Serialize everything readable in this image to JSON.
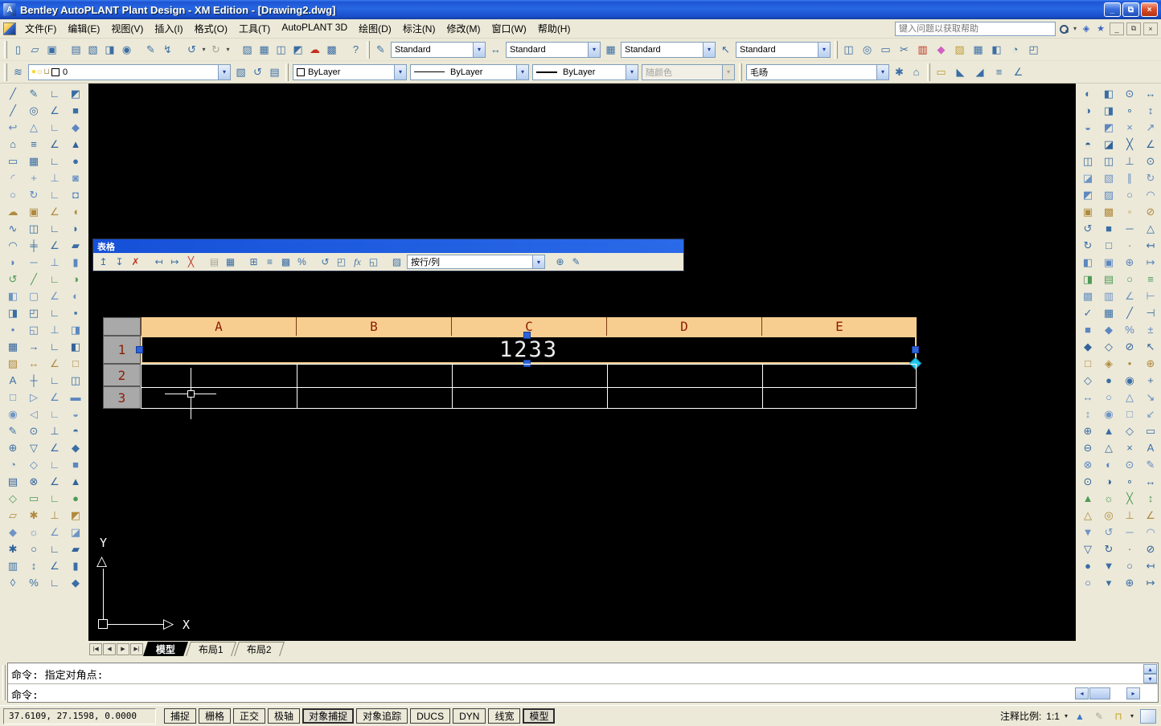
{
  "window": {
    "title": "Bentley AutoPLANT Plant Design - XM Edition - [Drawing2.dwg]",
    "app_initial": "A",
    "minimize": "_",
    "restore": "⧉",
    "close": "×"
  },
  "menubar": {
    "items": [
      "文件(F)",
      "编辑(E)",
      "视图(V)",
      "插入(I)",
      "格式(O)",
      "工具(T)",
      "AutoPLANT 3D",
      "绘图(D)",
      "标注(N)",
      "修改(M)",
      "窗口(W)",
      "帮助(H)"
    ],
    "search_placeholder": "键入问题以获取帮助",
    "comm_icon": "◈",
    "star_icon": "★",
    "doc_minimize": "_",
    "doc_restore": "⧉",
    "doc_close": "×"
  },
  "icons": {
    "combo_arrow": "▾",
    "up": "▴",
    "down": "▾",
    "left": "◂",
    "right": "▸"
  },
  "toolbar1": {
    "left_icons": [
      {
        "name": "new-icon",
        "g": "▯"
      },
      {
        "name": "open-icon",
        "g": "▱"
      },
      {
        "name": "save-icon",
        "g": "▣"
      },
      {
        "name": "plot-icon",
        "g": "▤",
        "class": "sep"
      },
      {
        "name": "plot-preview-icon",
        "g": "▧"
      },
      {
        "name": "publish-icon",
        "g": "◨"
      },
      {
        "name": "dwf-icon",
        "g": "◉"
      },
      {
        "name": "paint-icon",
        "g": "✎",
        "class": "sep"
      },
      {
        "name": "match-properties-icon",
        "g": "↯"
      },
      {
        "name": "undo-icon",
        "g": "↺",
        "class": "sep"
      },
      {
        "name": "undo-arrow-icon",
        "g": "▾",
        "class": "dd"
      },
      {
        "name": "redo-icon",
        "g": "↻",
        "class": "dim"
      },
      {
        "name": "redo-arrow-icon",
        "g": "▾",
        "class": "dd"
      },
      {
        "name": "sheet-set-icon",
        "g": "▨",
        "class": "sep"
      },
      {
        "name": "quickcalc-icon",
        "g": "▦"
      },
      {
        "name": "block-editor-icon",
        "g": "◫"
      },
      {
        "name": "markup-icon",
        "g": "◩"
      },
      {
        "name": "revision-icon",
        "g": "☁",
        "class": "red"
      },
      {
        "name": "calculator-icon",
        "g": "▩"
      },
      {
        "name": "help-icon",
        "g": "?",
        "class": "sep"
      }
    ],
    "styles": [
      {
        "name": "text-style-combo",
        "icon": "✎",
        "value": "Standard"
      },
      {
        "name": "dim-style-combo",
        "icon": "↔",
        "value": "Standard"
      },
      {
        "name": "table-style-combo",
        "icon": "▦",
        "value": "Standard"
      },
      {
        "name": "mleader-style-combo",
        "icon": "↖",
        "value": "Standard"
      }
    ],
    "right_icons": [
      {
        "name": "equipment-icon",
        "g": "◫"
      },
      {
        "name": "browse-icon",
        "g": "◎"
      },
      {
        "name": "fence-icon",
        "g": "▭"
      },
      {
        "name": "cut-icon",
        "g": "✂"
      },
      {
        "name": "train-icon",
        "g": "▥",
        "class": "red"
      },
      {
        "name": "check-icon",
        "g": "◆",
        "class": "pink"
      },
      {
        "name": "tools-icon",
        "g": "▨",
        "class": "gold"
      },
      {
        "name": "map-icon",
        "g": "▦"
      },
      {
        "name": "tree-icon",
        "g": "◧"
      },
      {
        "name": "find-icon",
        "g": "◔"
      },
      {
        "name": "door-icon",
        "g": "◰"
      }
    ]
  },
  "toolbar2": {
    "layer": {
      "value": "0"
    },
    "layer_tools": [
      {
        "name": "layer-states-icon",
        "g": "▧"
      },
      {
        "name": "layer-previous-icon",
        "g": "↺"
      },
      {
        "name": "layer-manager-icon",
        "g": "▤"
      }
    ],
    "color": {
      "value": "ByLayer"
    },
    "linetype": {
      "value": "ByLayer"
    },
    "lineweight": {
      "value": "ByLayer"
    },
    "plotstyle": {
      "value": "随颜色"
    },
    "workspace": {
      "value": "毛旸"
    },
    "gear_icon": "✱",
    "home_icon": "⌂",
    "tail_icons": [
      {
        "name": "measure-icon",
        "g": "▭",
        "class": "gold"
      },
      {
        "name": "surface1-icon",
        "g": "◣"
      },
      {
        "name": "surface2-icon",
        "g": "◢"
      },
      {
        "name": "list-icon",
        "g": "≡"
      },
      {
        "name": "angle-icon",
        "g": "∠"
      }
    ]
  },
  "table_toolbar": {
    "title": "表格",
    "icons": [
      {
        "name": "insert-row-above-icon",
        "g": "↥"
      },
      {
        "name": "insert-row-below-icon",
        "g": "↧"
      },
      {
        "name": "delete-row-icon",
        "g": "✗",
        "class": "red"
      },
      {
        "name": "insert-col-left-icon",
        "g": "↤",
        "class": "sep"
      },
      {
        "name": "insert-col-right-icon",
        "g": "↦"
      },
      {
        "name": "delete-col-icon",
        "g": "╳",
        "class": "red"
      },
      {
        "name": "merge-cells-icon",
        "g": "▤",
        "class": "dim sep"
      },
      {
        "name": "unmerge-cells-icon",
        "g": "▦"
      },
      {
        "name": "cell-borders-icon",
        "g": "⊞",
        "class": "sep"
      },
      {
        "name": "alignment-icon",
        "g": "≡"
      },
      {
        "name": "cell-format-icon",
        "g": "▩"
      },
      {
        "name": "percent-icon",
        "g": "%"
      },
      {
        "name": "insert-block-icon",
        "g": "↺",
        "class": "sep"
      },
      {
        "name": "insert-field-icon",
        "g": "◰"
      },
      {
        "name": "formula-icon",
        "g": "fx",
        "class": "fx"
      },
      {
        "name": "manage-content-icon",
        "g": "◱"
      },
      {
        "name": "match-cell-icon",
        "g": "▨",
        "class": "sep"
      }
    ],
    "combo_value": "按行/列",
    "tail_icons": [
      {
        "name": "link-cell-icon",
        "g": "⊕"
      },
      {
        "name": "download-data-icon",
        "g": "✎"
      }
    ]
  },
  "drawing": {
    "table": {
      "columns": [
        "A",
        "B",
        "C",
        "D",
        "E"
      ],
      "row_numbers": [
        {
          "n": "1",
          "class": "r1"
        },
        {
          "n": "2",
          "class": "r2"
        },
        {
          "n": "3",
          "class": "r3"
        }
      ],
      "selected_value": "1233"
    },
    "ucs": {
      "x": "X",
      "y": "Y",
      "y_arrow": "△",
      "x_arrow": "▷"
    },
    "tab_nav": [
      "|◀",
      "◀",
      "▶",
      "▶|"
    ],
    "tabs": [
      {
        "label": "模型",
        "class": "active"
      },
      {
        "label": "布局1"
      },
      {
        "label": "布局2"
      }
    ]
  },
  "command": {
    "line1": "命令: 指定对角点:",
    "line2": "命令:"
  },
  "statusbar": {
    "coordinates": "37.6109, 27.1598, 0.0000",
    "toggles": [
      {
        "label": "捕捉"
      },
      {
        "label": "栅格"
      },
      {
        "label": "正交"
      },
      {
        "label": "极轴"
      },
      {
        "label": "对象捕捉",
        "class": "pressed"
      },
      {
        "label": "对象追踪"
      },
      {
        "label": "DUCS"
      },
      {
        "label": "DYN"
      },
      {
        "label": "线宽"
      },
      {
        "label": "模型",
        "class": "pressed"
      }
    ],
    "annotation": {
      "label": "注释比例:",
      "value": "1:1"
    },
    "right_icons": [
      {
        "name": "annotation-visibility-icon",
        "g": "▲"
      },
      {
        "name": "auto-annotate-icon",
        "g": "✎",
        "class": "dim"
      },
      {
        "name": "lock-icon",
        "g": "⊓",
        "class": "gold"
      },
      {
        "name": "status-menu-arrow-icon",
        "g": "▾",
        "class": "ddar"
      }
    ]
  },
  "dock_left": {
    "col1": [
      "╱",
      "╱",
      "↩",
      "⌂",
      "▭",
      "◜",
      "○",
      "☁",
      "∿",
      "◠",
      "◗",
      "↺",
      "◧",
      "◨",
      "•",
      "▦",
      "▨",
      "A",
      "□",
      "◉",
      "✎",
      "⊕",
      "◔",
      "▤",
      "◇",
      "▱",
      "◆",
      "✱",
      "▥",
      "◊"
    ],
    "col2": [
      "✎",
      "◎",
      "△",
      "≡",
      "▦",
      "+",
      "↻",
      "▣",
      "◫",
      "╪",
      "─",
      "╱",
      "▢",
      "◰",
      "◱",
      "→",
      "↔",
      "┼",
      "▷",
      "◁",
      "⊙",
      "▽",
      "◇",
      "⊗",
      "▭",
      "✱",
      "☼",
      "○",
      "↕",
      "%"
    ],
    "col3": [
      "∟",
      "∠",
      "∟",
      "∠",
      "∟",
      "⊥",
      "∟",
      "∠",
      "∟",
      "∠",
      "⊥",
      "∟",
      "∠",
      "∟",
      "⊥",
      "∟",
      "∠",
      "∟",
      "∠",
      "∟",
      "⊥",
      "∠",
      "∟",
      "∠",
      "∟",
      "⊥",
      "∠",
      "∟",
      "∠",
      "∟"
    ],
    "col4": [
      "◩",
      "■",
      "◆",
      "▲",
      "●",
      "◙",
      "◘",
      "◖",
      "◗",
      "▰",
      "▮",
      "◑",
      "◐",
      "▪",
      "◨",
      "◧",
      "□",
      "◫",
      "▬",
      "◒",
      "◓",
      "◆",
      "■",
      "▲",
      "●",
      "◩",
      "◪",
      "▰",
      "▮",
      "◆"
    ]
  },
  "dock_right": {
    "col1": [
      "◐",
      "◑",
      "◒",
      "◓",
      "◫",
      "◪",
      "◩",
      "▣",
      "↺",
      "↻",
      "◧",
      "◨",
      "▩",
      "✓",
      "■",
      "◆",
      "□",
      "◇",
      "↔",
      "↕",
      "⊕",
      "⊖",
      "⊗",
      "⊙",
      "▲",
      "△",
      "▼",
      "▽",
      "●",
      "○"
    ],
    "col2": [
      "◧",
      "◨",
      "◩",
      "◪",
      "◫",
      "▧",
      "▨",
      "▩",
      "■",
      "□",
      "▣",
      "▤",
      "▥",
      "▦",
      "◆",
      "◇",
      "◈",
      "●",
      "○",
      "◉",
      "▲",
      "△",
      "◐",
      "◑",
      "☼",
      "◎",
      "↺",
      "↻",
      "▼",
      "▾"
    ],
    "col3": [
      "⊙",
      "∘",
      "×",
      "╳",
      "⊥",
      "∥",
      "○",
      "◦",
      "─",
      "·",
      "⊕",
      "○",
      "∠",
      "╱",
      "%",
      "⊘",
      "•",
      "◉",
      "△",
      "□",
      "◇",
      "×",
      "⊙",
      "∘",
      "╳",
      "⊥",
      "─",
      "·",
      "○",
      "⊕"
    ],
    "col4": [
      "↔",
      "↕",
      "↗",
      "∠",
      "⊙",
      "↻",
      "◠",
      "⊘",
      "△",
      "↤",
      "↦",
      "≡",
      "⊢",
      "⊣",
      "±",
      "↖",
      "⊕",
      "+",
      "↘",
      "↙",
      "▭",
      "A",
      "✎",
      "↔",
      "↕",
      "∠",
      "◠",
      "⊘",
      "↤",
      "↦"
    ]
  },
  "colors": {
    "titlebar_blue": "#2767E2",
    "close_button": "#DD4F28",
    "canvas": "#000000",
    "table_header": "#F8CE90",
    "table_header_text": "#8B1E04",
    "row_header_gray": "#A9A9A9",
    "grip_blue": "#2E64D8",
    "grip_diamond_cyan": "#22C8EE",
    "chrome": "#ECE9D8"
  }
}
